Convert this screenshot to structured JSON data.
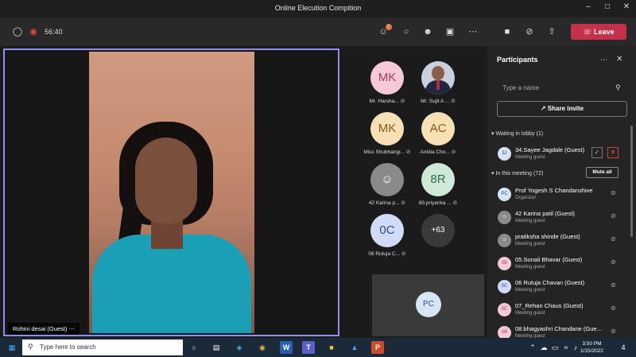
{
  "window": {
    "title": "Online Elecution Compition"
  },
  "toolbar": {
    "timer": "56:40",
    "leave_label": "Leave",
    "participants_badge": "!"
  },
  "stage": {
    "main_name": "Rohini desai (Guest)",
    "tiles": [
      {
        "initials": "MK",
        "label": "Mr. Harsha...",
        "bg": "#f6c9d8",
        "fg": "#a9405f"
      },
      {
        "initials": "",
        "label": "Mr. Sujit A ...",
        "bg": "#4e5a7a",
        "fg": "#ffffff"
      },
      {
        "initials": "MK",
        "label": "Miss Shubhangi...",
        "bg": "#f7e0b5",
        "fg": "#8a5a16"
      },
      {
        "initials": "AC",
        "label": "Ankita Cho...",
        "bg": "#f7e0b5",
        "fg": "#8a5a16"
      },
      {
        "initials": "",
        "label": "42 Karina p...",
        "bg": "#8a8a8a",
        "fg": "#ffffff"
      },
      {
        "initials": "8R",
        "label": "89.priyanka ...",
        "bg": "#cfe9d8",
        "fg": "#2f6e48"
      },
      {
        "initials": "0C",
        "label": "06 Rutuja C...",
        "bg": "#cfdbf7",
        "fg": "#2d4b8e"
      },
      {
        "initials": "+63",
        "label": "",
        "bg": "#3a3a3a",
        "fg": "#ffffff"
      }
    ],
    "self_initials": "PC"
  },
  "panel": {
    "title": "Participants",
    "search_placeholder": "Type a name",
    "share_label": "Share invite",
    "lobby_header": "Waiting in lobby (1)",
    "meeting_header": "In this meeting (72)",
    "mute_all_label": "Mute all",
    "lobby": [
      {
        "initials": "3J",
        "name": "34.Sayee Jagdale (Guest)",
        "role": "Meeting guest",
        "bg": "#d6e6f5",
        "fg": "#2d4b8e"
      }
    ],
    "participants": [
      {
        "initials": "PC",
        "name": "Prof Yogesh S Chandanshive",
        "role": "Organizer",
        "bg": "#d6e6f5",
        "fg": "#2d4b8e"
      },
      {
        "initials": "",
        "name": "42 Karina patil (Guest)",
        "role": "Meeting guest",
        "bg": "#8a8a8a",
        "fg": "#ffffff"
      },
      {
        "initials": "",
        "name": "pratiksha shinde (Guest)",
        "role": "Meeting guest",
        "bg": "#8a8a8a",
        "fg": "#ffffff"
      },
      {
        "initials": "0B",
        "name": "05.Sonali Bhavar (Guest)",
        "role": "Meeting guest",
        "bg": "#f6c9d8",
        "fg": "#a9405f"
      },
      {
        "initials": "0C",
        "name": "06 Rutuja Chavan (Guest)",
        "role": "Meeting guest",
        "bg": "#cfdbf7",
        "fg": "#2d4b8e"
      },
      {
        "initials": "0C",
        "name": "07_Rehan Chaus (Guest)",
        "role": "Meeting guest",
        "bg": "#f6c9d8",
        "fg": "#a9405f"
      },
      {
        "initials": "0B",
        "name": "08.bhagyashri Chandane (Gue...",
        "role": "Meeting guest",
        "bg": "#f6c9d8",
        "fg": "#a9405f"
      }
    ]
  },
  "taskbar": {
    "search_placeholder": "Type here to search",
    "time": "3:50 PM",
    "date": "1/15/2022",
    "notif_count": "4"
  }
}
